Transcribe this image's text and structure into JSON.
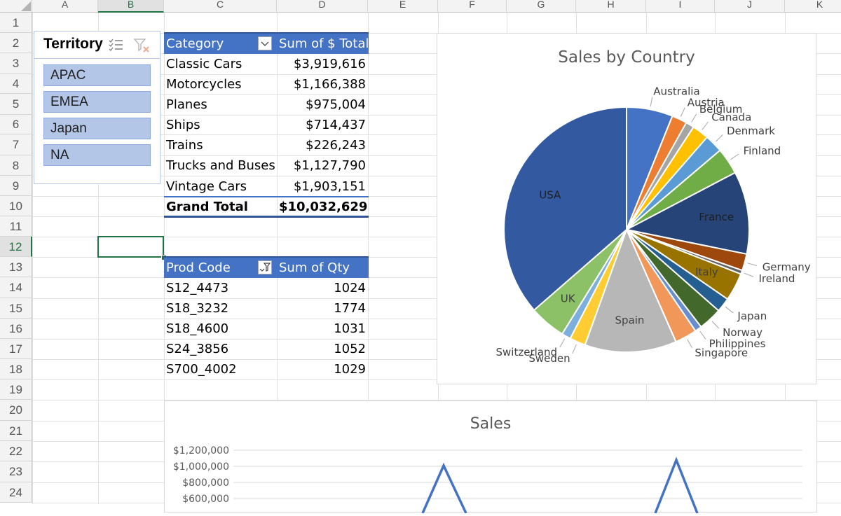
{
  "columns": [
    "A",
    "B",
    "C",
    "D",
    "E",
    "F",
    "G",
    "H",
    "I",
    "J",
    "K"
  ],
  "rows": [
    "1",
    "2",
    "3",
    "4",
    "5",
    "6",
    "7",
    "8",
    "9",
    "10",
    "11",
    "12",
    "13",
    "14",
    "15",
    "16",
    "17",
    "18",
    "19",
    "20",
    "21",
    "22",
    "23",
    "24"
  ],
  "slicer": {
    "title": "Territory",
    "items": [
      "APAC",
      "EMEA",
      "Japan",
      "NA"
    ]
  },
  "pivot1": {
    "header_left": "Category",
    "header_right": "Sum of $ Total",
    "rows": [
      {
        "label": "Classic Cars",
        "value": "$3,919,616"
      },
      {
        "label": "Motorcycles",
        "value": "$1,166,388"
      },
      {
        "label": "Planes",
        "value": "$975,004"
      },
      {
        "label": "Ships",
        "value": "$714,437"
      },
      {
        "label": "Trains",
        "value": "$226,243"
      },
      {
        "label": "Trucks and Buses",
        "value": "$1,127,790"
      },
      {
        "label": "Vintage Cars",
        "value": "$1,903,151"
      }
    ],
    "total_label": "Grand Total",
    "total_value": "$10,032,629"
  },
  "pivot2": {
    "header_left": "Prod Code",
    "header_right": "Sum of Qty",
    "rows": [
      {
        "label": "S12_4473",
        "value": "1024"
      },
      {
        "label": "S18_3232",
        "value": "1774"
      },
      {
        "label": "S18_4600",
        "value": "1031"
      },
      {
        "label": "S24_3856",
        "value": "1052"
      },
      {
        "label": "S700_4002",
        "value": "1029"
      }
    ]
  },
  "chart_data": [
    {
      "type": "pie",
      "title": "Sales by Country",
      "categories": [
        "Australia",
        "Austria",
        "Belgium",
        "Canada",
        "Denmark",
        "Finland",
        "France",
        "Germany",
        "Ireland",
        "Italy",
        "Japan",
        "Norway",
        "Philippines",
        "Singapore",
        "Spain",
        "Sweden",
        "Switzerland",
        "UK",
        "USA"
      ],
      "values": [
        6.1,
        2.0,
        1.1,
        2.2,
        2.4,
        3.5,
        10.9,
        2.2,
        0.5,
        3.7,
        1.9,
        3.1,
        0.9,
        2.9,
        12.1,
        2.1,
        1.2,
        4.8,
        36.4
      ],
      "colors": [
        "#4472c4",
        "#ed7d31",
        "#a5a5a5",
        "#ffc000",
        "#5b9bd5",
        "#70ad47",
        "#264478",
        "#9e480e",
        "#636363",
        "#997300",
        "#255e91",
        "#43682b",
        "#698ed0",
        "#f1975a",
        "#b7b7b7",
        "#ffcd33",
        "#7cafdd",
        "#8cc168",
        "#335aa1"
      ]
    },
    {
      "type": "line",
      "title": "Sales",
      "y_ticks": [
        "$1,200,000",
        "$1,000,000",
        "$800,000",
        "$600,000"
      ],
      "ylim": [
        600000,
        1200000
      ],
      "color": "#4472c4"
    }
  ]
}
